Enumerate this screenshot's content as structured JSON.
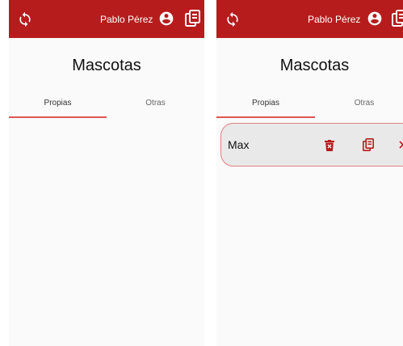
{
  "colors": {
    "appbar": "#b71c1c",
    "accent": "#e05555",
    "card_bg": "#e9e9e9",
    "card_border": "#e08080",
    "background": "#fafafa"
  },
  "icons": {
    "refresh": "refresh-icon",
    "account": "account-circle-icon",
    "docs": "document-copy-icon",
    "delete": "trash-icon",
    "chevron": "chevron-right-icon"
  },
  "screens": [
    {
      "appbar": {
        "user_name": "Pablo Pérez"
      },
      "title": "Mascotas",
      "tabs": [
        {
          "label": "Propias",
          "active": true
        },
        {
          "label": "Otras",
          "active": false
        }
      ],
      "pets": []
    },
    {
      "appbar": {
        "user_name": "Pablo Pérez"
      },
      "title": "Mascotas",
      "tabs": [
        {
          "label": "Propias",
          "active": true
        },
        {
          "label": "Otras",
          "active": false
        }
      ],
      "pets": [
        {
          "name": "Max"
        }
      ]
    }
  ]
}
